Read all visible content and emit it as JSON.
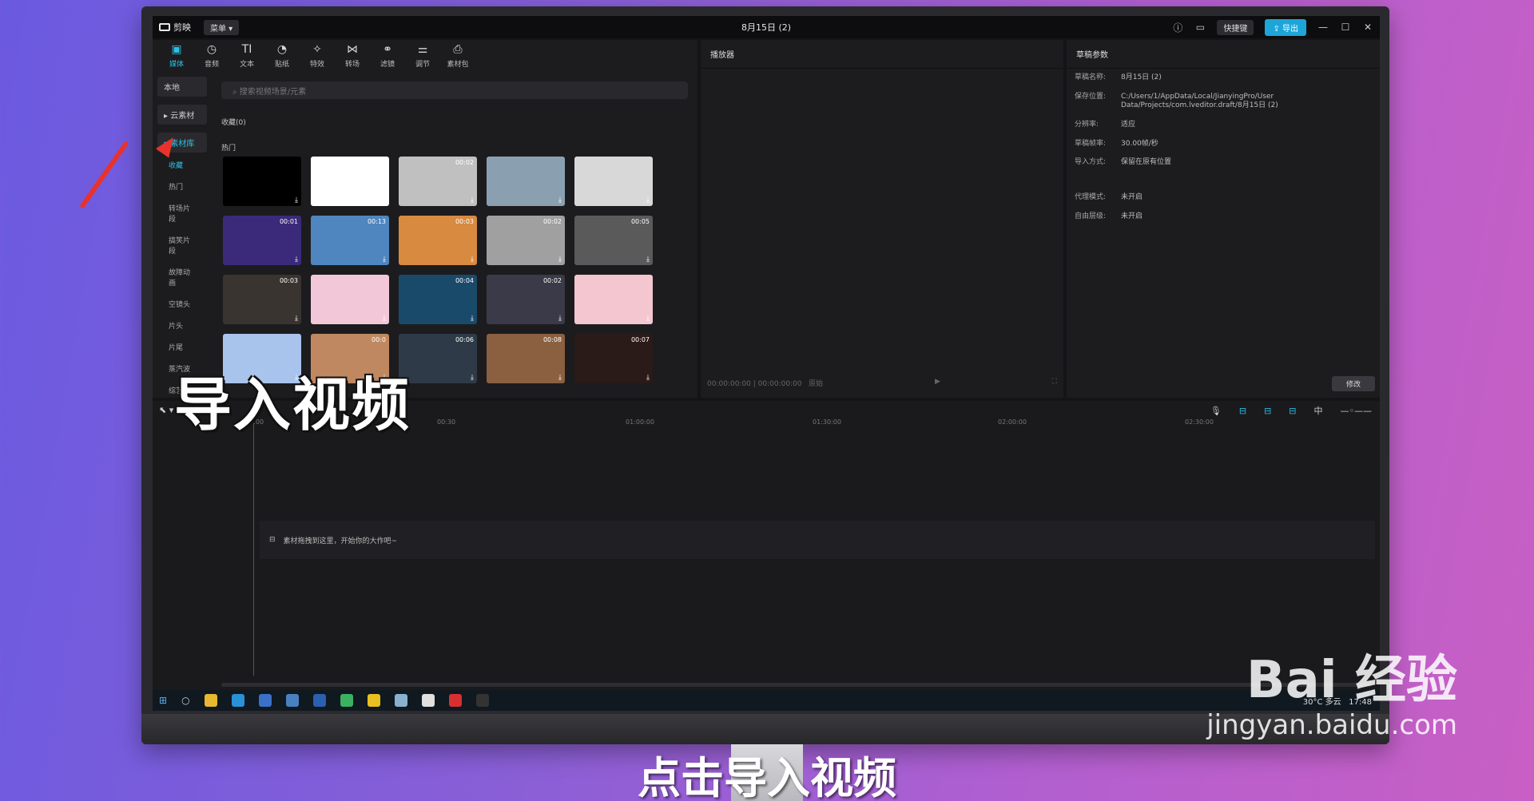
{
  "titlebar": {
    "app_name": "剪映",
    "menu_label": "菜单",
    "project_title": "8月15日 (2)",
    "shortcut_label": "快捷键",
    "export_label": "导出"
  },
  "toolbar": {
    "tabs": [
      {
        "label": "媒体",
        "icon": "media-icon"
      },
      {
        "label": "音频",
        "icon": "audio-icon"
      },
      {
        "label": "文本",
        "icon": "text-icon"
      },
      {
        "label": "贴纸",
        "icon": "sticker-icon"
      },
      {
        "label": "特效",
        "icon": "effects-icon"
      },
      {
        "label": "转场",
        "icon": "transition-icon"
      },
      {
        "label": "滤镜",
        "icon": "filter-icon"
      },
      {
        "label": "调节",
        "icon": "adjust-icon"
      },
      {
        "label": "素材包",
        "icon": "package-icon"
      }
    ]
  },
  "sidenav": {
    "local": "本地",
    "cloud": "云素材",
    "library": "素材库",
    "subitems": [
      "收藏",
      "热门",
      "转场片段",
      "搞笑片段",
      "故障动画",
      "空镜头",
      "片头",
      "片尾",
      "蒸汽波",
      "综艺"
    ]
  },
  "search": {
    "placeholder": "搜索视频场景/元素"
  },
  "sections": {
    "favorites": "收藏(0)",
    "hot": "热门"
  },
  "thumbnails": [
    {
      "duration": "",
      "color": "#000000"
    },
    {
      "duration": "",
      "color": "#ffffff"
    },
    {
      "duration": "00:02",
      "color": "#c0c0c0"
    },
    {
      "duration": "",
      "color": "#8aa0b0"
    },
    {
      "duration": "",
      "color": "#d8d8d8"
    },
    {
      "duration": "00:01",
      "color": "#3b2a7a"
    },
    {
      "duration": "00:13",
      "color": "#4f86c0"
    },
    {
      "duration": "00:03",
      "color": "#d88a40"
    },
    {
      "duration": "00:02",
      "color": "#a0a0a0"
    },
    {
      "duration": "00:05",
      "color": "#5a5a5a"
    },
    {
      "duration": "00:03",
      "color": "#3a3430"
    },
    {
      "duration": "",
      "color": "#f2c8d8"
    },
    {
      "duration": "00:04",
      "color": "#1a4a6a"
    },
    {
      "duration": "00:02",
      "color": "#3a3a48"
    },
    {
      "duration": "",
      "color": "#f4c6d0"
    },
    {
      "duration": "",
      "color": "#a8c4ec"
    },
    {
      "duration": "00:0",
      "color": "#c08860"
    },
    {
      "duration": "00:06",
      "color": "#2e3a48"
    },
    {
      "duration": "00:08",
      "color": "#8a6040"
    },
    {
      "duration": "00:07",
      "color": "#2a1a18"
    }
  ],
  "player": {
    "title": "播放器",
    "time_current": "00:00:00:00",
    "time_total": "00:00:00:00",
    "ratio": "原始"
  },
  "params": {
    "title": "草稿参数",
    "rows": [
      {
        "k": "草稿名称:",
        "v": "8月15日 (2)"
      },
      {
        "k": "保存位置:",
        "v": "C:/Users/1/AppData/Local/JianyingPro/User Data/Projects/com.lveditor.draft/8月15日 (2)"
      },
      {
        "k": "分辨率:",
        "v": "适应"
      },
      {
        "k": "草稿帧率:",
        "v": "30.00帧/秒"
      },
      {
        "k": "导入方式:",
        "v": "保留在原有位置"
      },
      {
        "k": "代理模式:",
        "v": "未开启"
      },
      {
        "k": "自由层级:",
        "v": "未开启"
      }
    ],
    "modify_label": "修改"
  },
  "timeline": {
    "ruler": [
      "00:00",
      "00:30",
      "01:00:00",
      "01:30:00",
      "02:00:00",
      "02:30:00"
    ],
    "drop_hint": "素材拖拽到这里，开始你的大作吧~"
  },
  "taskbar": {
    "weather": "30°C 多云",
    "time": "17:48"
  },
  "overlay": {
    "big_text": "导入视频",
    "subtitle": "点击导入视频"
  },
  "watermark": {
    "logo": "Bai 经验",
    "url": "jingyan.baidu.com"
  }
}
